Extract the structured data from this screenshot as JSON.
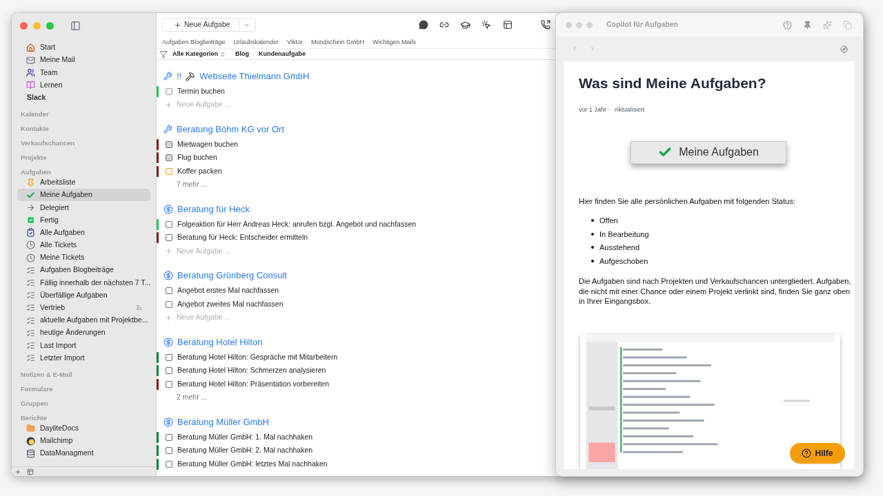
{
  "sidebar": {
    "top_items": [
      {
        "label": "Start",
        "kind": "home",
        "selected": false
      },
      {
        "label": "Meine Mail",
        "kind": "mail",
        "selected": false
      },
      {
        "label": "Team",
        "kind": "team",
        "selected": false
      },
      {
        "label": "Lernen",
        "kind": "books",
        "selected": false
      },
      {
        "label": "Slack",
        "kind": "plain",
        "selected": false
      }
    ],
    "sections": [
      {
        "title": "Kalender"
      },
      {
        "title": "Kontakte"
      },
      {
        "title": "Verkaufschancen"
      },
      {
        "title": "Projekte"
      },
      {
        "title": "Aufgaben",
        "items": [
          {
            "label": "Arbeitsliste",
            "kind": "pin",
            "selected": false
          },
          {
            "label": "Meine Aufgaben",
            "kind": "check",
            "selected": true
          },
          {
            "label": "Delegiert",
            "kind": "arrow",
            "selected": false
          },
          {
            "label": "Fertig",
            "kind": "done",
            "selected": false
          },
          {
            "label": "Alle Aufgaben",
            "kind": "list",
            "selected": false
          },
          {
            "label": "Alle Tickets",
            "kind": "ticket",
            "selected": false
          },
          {
            "label": "Meine Tickets",
            "kind": "ticket",
            "selected": false
          },
          {
            "label": "Aufgaben Blogbeiträge",
            "kind": "smart",
            "selected": false
          },
          {
            "label": "Fällig innerhalb der nächsten 7 T...",
            "kind": "smart",
            "selected": false
          },
          {
            "label": "Überfällige Aufgaben",
            "kind": "smart",
            "selected": false
          },
          {
            "label": "Vertrieb",
            "kind": "smart",
            "selected": false,
            "shared": true
          },
          {
            "label": "aktuelle Aufgaben mit Projektbe...",
            "kind": "smart",
            "selected": false
          },
          {
            "label": "heutige Änderungen",
            "kind": "smart",
            "selected": false
          },
          {
            "label": "Last Import",
            "kind": "import",
            "selected": false
          },
          {
            "label": "Letzter Import",
            "kind": "import",
            "selected": false
          }
        ]
      },
      {
        "title": "Notizen & E-Mail"
      },
      {
        "title": "Formulare"
      },
      {
        "title": "Gruppen"
      },
      {
        "title": "Berichte",
        "items": [
          {
            "label": "DayliteDocs",
            "kind": "folder",
            "selected": false
          },
          {
            "label": "Mailchimp",
            "kind": "mailchimp",
            "selected": false
          },
          {
            "label": "DataManagment",
            "kind": "database",
            "selected": false
          }
        ]
      }
    ]
  },
  "toolbar": {
    "new_task": "Neue Aufgabe"
  },
  "favorites": [
    "Aufgaben Blogbeiträge",
    "Urlaubskalender",
    "Viktor",
    "Mondschein GmbH",
    "Wichtigen Mails"
  ],
  "filter": {
    "category": "Alle Kategorien",
    "tags": [
      "Blog",
      "Kundenaufgabe"
    ]
  },
  "groups": [
    {
      "title": "Webseite Thielmann GmbH",
      "flag": "!!",
      "hammer": true,
      "kind": "project",
      "tasks": [
        {
          "title": "Termin buchen",
          "kind": "appointment",
          "checked": false,
          "color": "#22c55e"
        }
      ],
      "new_task": "Neue Aufgabe ..."
    },
    {
      "title": "Beratung Böhm KG vor Ort",
      "kind": "project",
      "tasks": [
        {
          "title": "Mietwagen buchen",
          "kind": "grey",
          "checked": false,
          "color": "#7f1d1d"
        },
        {
          "title": "Flug buchen",
          "kind": "grey",
          "checked": false,
          "color": "#7f1d1d"
        },
        {
          "title": "Koffer packen",
          "kind": "orange",
          "checked": false,
          "color": "#7f1d1d"
        }
      ],
      "more": "7 mehr ..."
    },
    {
      "title": "Beratung für Heck",
      "kind": "opportunity",
      "tasks": [
        {
          "title": "Folgeaktion für Herr Andreas Heck: anrufen bzgl. Angebot und nachfassen",
          "kind": "plain",
          "checked": false,
          "color": "#22c55e"
        },
        {
          "title": "Beratung für Heck: Entscheider ermitteln",
          "kind": "plain",
          "checked": false,
          "color": "#7f1d1d"
        }
      ],
      "new_task": "Neue Aufgabe ..."
    },
    {
      "title": "Beratung Grünberg Consult",
      "kind": "opportunity",
      "tasks": [
        {
          "title": "Angebot erstes Mal nachfassen",
          "kind": "plain",
          "checked": false
        },
        {
          "title": "Angebot zweites Mal nachfassen",
          "kind": "plain",
          "checked": false
        }
      ],
      "new_task": "Neue Aufgabe ..."
    },
    {
      "title": "Beratung Hotel Hilton",
      "kind": "opportunity",
      "tasks": [
        {
          "title": "Beratung Hotel Hilton: Gespräche mit Mitarbeitern",
          "kind": "plain",
          "checked": false,
          "color": "#15803d"
        },
        {
          "title": "Beratung Hotel Hilton: Schmerzen analysieren",
          "kind": "plain",
          "checked": false,
          "color": "#15803d"
        },
        {
          "title": "Beratung Hotel Hilton: Präsentation vorbereiten",
          "kind": "plain",
          "checked": false,
          "color": "#7f1d1d"
        }
      ],
      "more": "2 mehr ..."
    },
    {
      "title": "Beratung Müller GmbH",
      "kind": "opportunity",
      "tasks": [
        {
          "title": "Beratung Müller GmbH: 1. Mal nachhaken",
          "kind": "plain",
          "checked": false,
          "color": "#15803d"
        },
        {
          "title": "Beratung Müller GmbH: 2. Mal nachhaken",
          "kind": "plain",
          "checked": false,
          "color": "#15803d"
        },
        {
          "title": "Beratung Müller GmbH: letztes Mal nachhaken",
          "kind": "plain",
          "checked": false,
          "color": "#15803d"
        }
      ]
    }
  ],
  "copilot": {
    "title": "Copilot für Aufgaben",
    "article": {
      "heading": "Was sind Meine Aufgaben?",
      "meta": [
        "vor 1 Jahr ·",
        "Aktualisiert"
      ],
      "badge": "Meine Aufgaben",
      "intro": "Hier finden Sie alle persönlichen Aufgaben mit folgenden Status:",
      "bullets": [
        "Offen",
        "In Bearbeitung",
        "Ausstehend",
        "Aufgeschoben"
      ],
      "paragraph": "Die Aufgaben sind nach Projekten und Verkaufschancen untergliedert. Aufgaben, die nicht mit einer Chance oder einem Projekt verlinkt sind, finden Sie ganz oben in Ihrer Eingangsbox.",
      "image": {
        "kind": "picture"
      }
    },
    "help_button": "Hilfe"
  }
}
